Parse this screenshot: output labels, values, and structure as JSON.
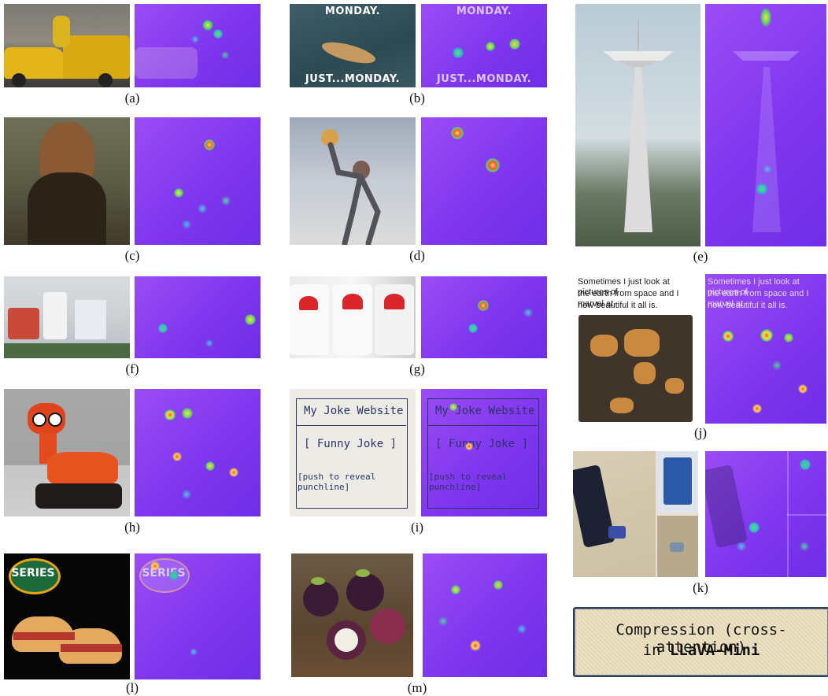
{
  "captions": {
    "a": "(a)",
    "b": "(b)",
    "c": "(c)",
    "d": "(d)",
    "e": "(e)",
    "f": "(f)",
    "g": "(g)",
    "h": "(h)",
    "i": "(i)",
    "j": "(j)",
    "k": "(k)",
    "l": "(l)",
    "m": "(m)"
  },
  "meme": {
    "top": "MONDAY.",
    "bottom": "JUST...MONDAY."
  },
  "tweet": {
    "line1": "Sometimes I just look at pictures of",
    "line2": "the earth from space and I marvel at",
    "line3": "how beautiful it all is."
  },
  "sketch": {
    "title": "My Joke Website",
    "joke": "[ Funny Joke ]",
    "punch": "[push to reveal punchline]"
  },
  "logo": {
    "series": "SERIES"
  },
  "box": {
    "line1": "Compression (cross-attention)",
    "line2_prefix": "in ",
    "line2_bold": "LLaVA-Mini"
  },
  "colors": {
    "heat_base": "#8a3df0",
    "box_border": "#2d3f5c",
    "box_bg": "#ece2c6"
  }
}
